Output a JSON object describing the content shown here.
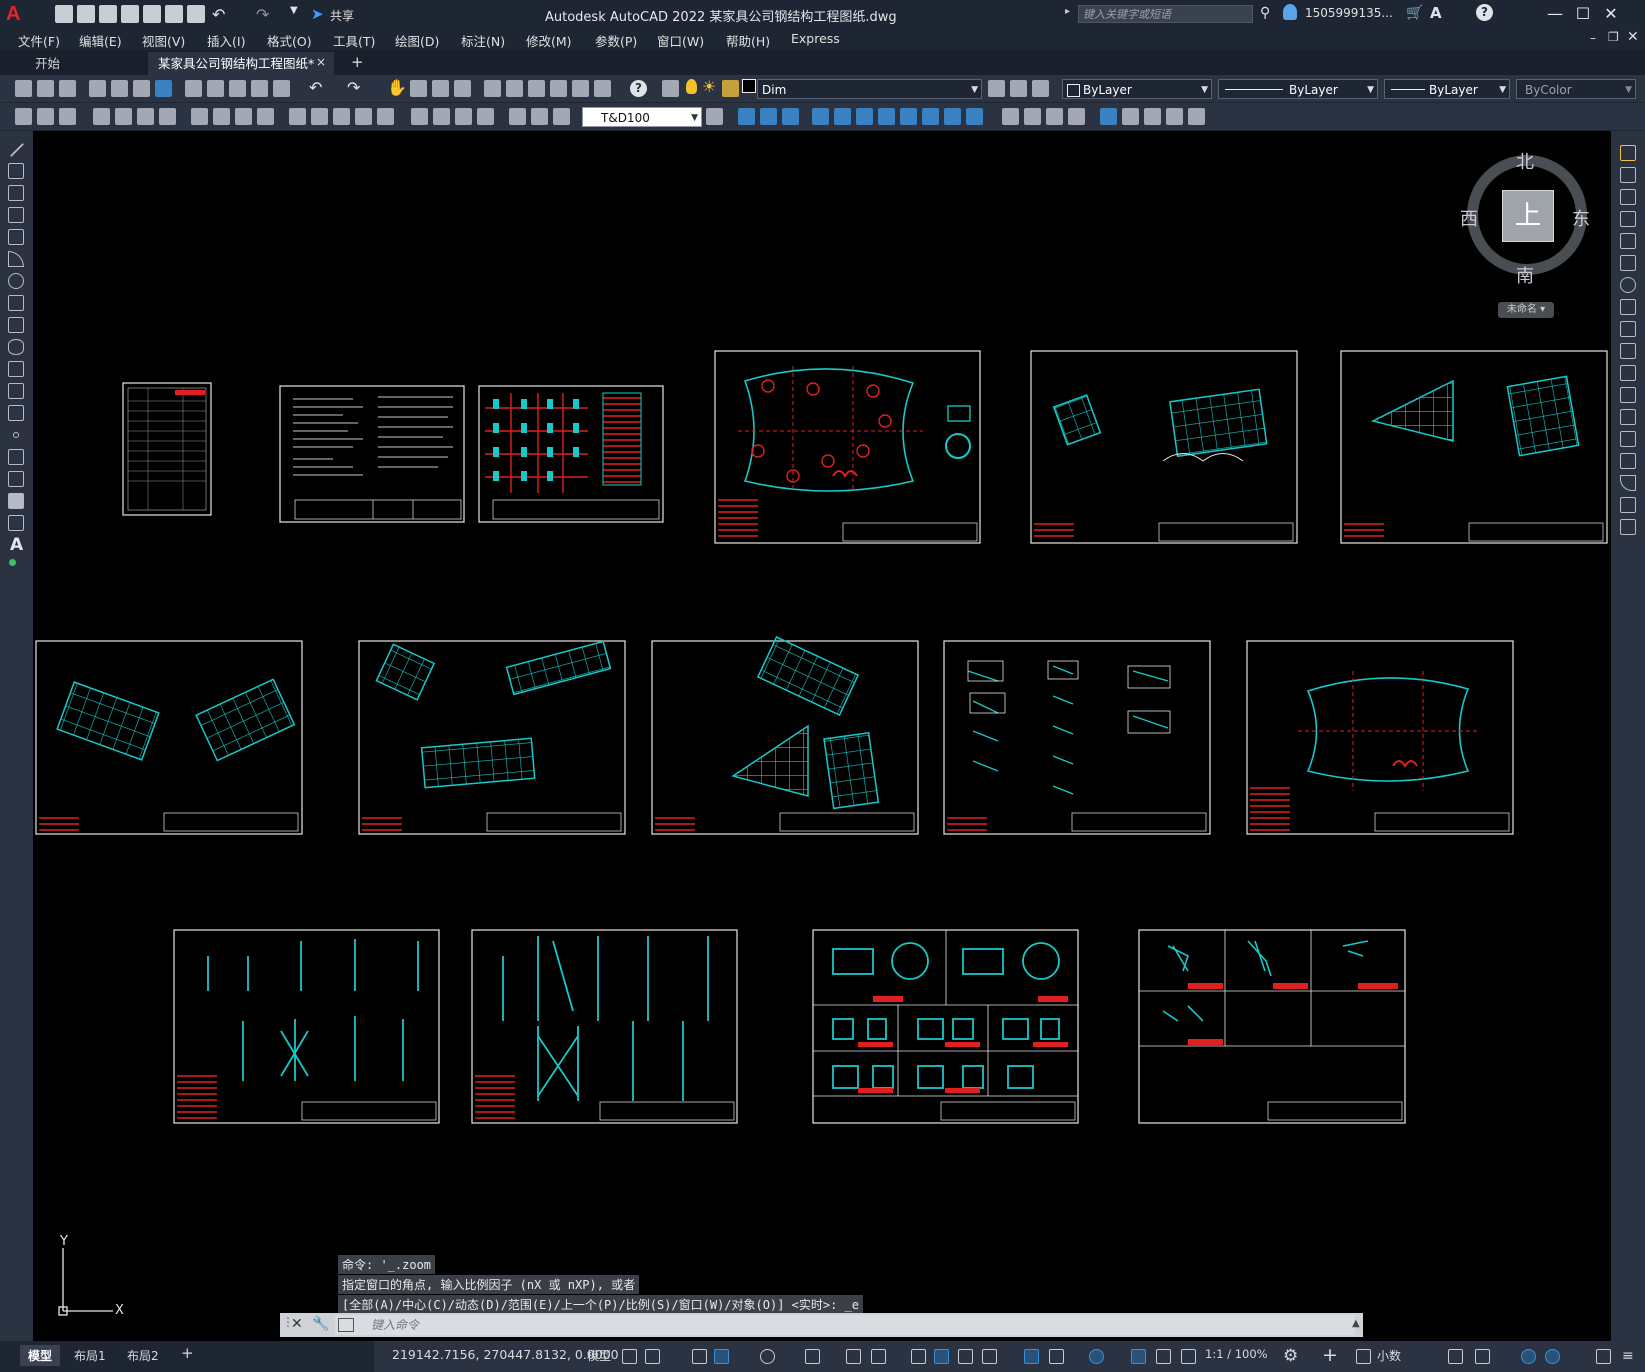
{
  "window": {
    "title": "Autodesk AutoCAD 2022    某家具公司钢结构工程图纸.dwg",
    "search_placeholder": "键入关键字或短语",
    "user": "1505999135...",
    "share_label": "共享"
  },
  "menu": [
    "文件(F)",
    "编辑(E)",
    "视图(V)",
    "插入(I)",
    "格式(O)",
    "工具(T)",
    "绘图(D)",
    "标注(N)",
    "修改(M)",
    "参数(P)",
    "窗口(W)",
    "帮助(H)",
    "Express"
  ],
  "tabs": {
    "start": "开始",
    "drawing": "某家具公司钢结构工程图纸*",
    "close": "×",
    "add": "+"
  },
  "toolbar": {
    "layer_value": "Dim",
    "color_value": "ByLayer",
    "linetype_value": "ByLayer",
    "lineweight_value": "ByLayer",
    "plotstyle_value": "ByColor",
    "dimstyle_value": "T&D100"
  },
  "viewcube": {
    "north": "北",
    "south": "南",
    "east": "东",
    "west": "西",
    "face": "上",
    "ucs": "未命名"
  },
  "ucs_icon": {
    "x_label": "X",
    "y_label": "Y"
  },
  "command": {
    "history": [
      "命令: '_.zoom",
      "指定窗口的角点, 输入比例因子 (nX 或 nXP), 或者",
      "[全部(A)/中心(C)/动态(D)/范围(E)/上一个(P)/比例(S)/窗口(W)/对象(O)] <实时>: _e"
    ],
    "placeholder": "键入命令"
  },
  "status": {
    "layout_tabs": [
      "模型",
      "布局1",
      "布局2"
    ],
    "add_layout": "+",
    "coordinates": "219142.7156, 270447.8132, 0.0000",
    "model_label": "模型",
    "scale": "1:1 / 100%",
    "units": "小数"
  },
  "colors": {
    "canvas_bg": "#000000",
    "ui_bg": "#2b3343",
    "geometry_cyan": "#19c8c8",
    "geometry_red": "#e02020",
    "sheet_border": "#e6e6e6"
  }
}
